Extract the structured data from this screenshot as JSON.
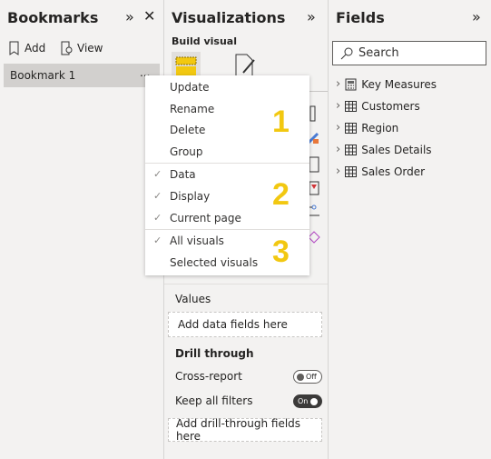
{
  "bookmarks": {
    "title": "Bookmarks",
    "add": "Add",
    "view": "View",
    "items": [
      "Bookmark 1"
    ],
    "more": "..."
  },
  "menu": {
    "group1": [
      "Update",
      "Rename",
      "Delete",
      "Group"
    ],
    "group2": [
      "Data",
      "Display",
      "Current page"
    ],
    "group3": [
      "All visuals",
      "Selected visuals"
    ],
    "checked": {
      "Data": true,
      "Display": true,
      "Current page": true,
      "All visuals": true,
      "Selected visuals": false
    },
    "annotations": [
      "1",
      "2",
      "3"
    ],
    "annotation_color": "#f2c811"
  },
  "viz": {
    "title": "Visualizations",
    "build_visual": "Build visual",
    "values_label": "Values",
    "values_placeholder": "Add data fields here",
    "drill_title": "Drill through",
    "cross_report": "Cross-report",
    "cross_report_state": "Off",
    "keep_filters": "Keep all filters",
    "keep_filters_state": "On",
    "drill_placeholder": "Add drill-through fields here"
  },
  "fields": {
    "title": "Fields",
    "search_placeholder": "Search",
    "tables": [
      {
        "name": "Key Measures",
        "icon": "calculator-icon"
      },
      {
        "name": "Customers",
        "icon": "table-icon"
      },
      {
        "name": "Region",
        "icon": "table-icon"
      },
      {
        "name": "Sales Details",
        "icon": "table-icon"
      },
      {
        "name": "Sales Order",
        "icon": "table-icon"
      }
    ]
  }
}
